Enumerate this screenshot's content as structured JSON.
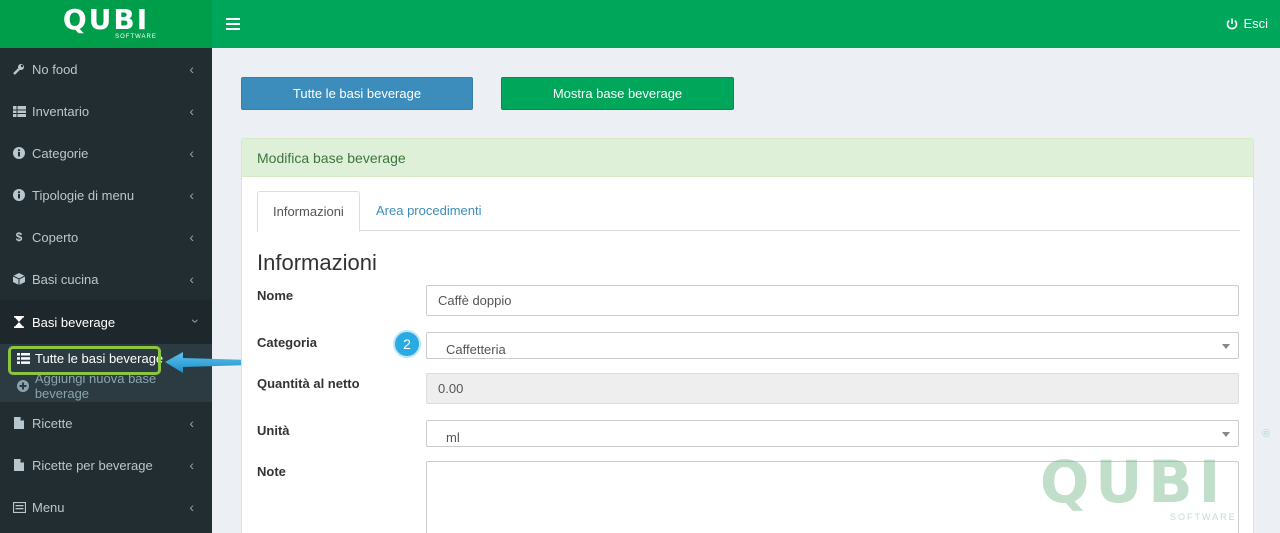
{
  "logo": {
    "text": "QUBI",
    "sub": "SOFTWARE"
  },
  "header": {
    "logout_label": "Esci"
  },
  "sidebar": {
    "items": [
      {
        "label": "No food",
        "icon": "wrench-icon"
      },
      {
        "label": "Inventario",
        "icon": "table-icon"
      },
      {
        "label": "Categorie",
        "icon": "info-icon"
      },
      {
        "label": "Tipologie di menu",
        "icon": "info-icon"
      },
      {
        "label": "Coperto",
        "icon": "dollar-icon"
      },
      {
        "label": "Basi cucina",
        "icon": "cube-icon"
      },
      {
        "label": "Basi beverage",
        "icon": "hourglass-icon"
      },
      {
        "label": "Ricette",
        "icon": "file-icon"
      },
      {
        "label": "Ricette per beverage",
        "icon": "file-icon"
      },
      {
        "label": "Menu",
        "icon": "list-alt-icon"
      }
    ],
    "submenu": [
      {
        "label": "Tutte le basi beverage",
        "icon": "list-icon"
      },
      {
        "label": "Aggiungi nuova base beverage",
        "icon": "plus-circle-icon"
      }
    ]
  },
  "actions": {
    "all_label": "Tutte le basi beverage",
    "show_label": "Mostra base beverage"
  },
  "panel": {
    "title": "Modifica base beverage",
    "tabs": [
      {
        "label": "Informazioni"
      },
      {
        "label": "Area procedimenti"
      }
    ],
    "section_title": "Informazioni",
    "fields": {
      "nome": {
        "label": "Nome",
        "value": "Caffè doppio"
      },
      "categoria": {
        "label": "Categoria",
        "value": "Caffetteria"
      },
      "quantita": {
        "label": "Quantità al netto",
        "value": "0.00"
      },
      "unita": {
        "label": "Unità",
        "value": "ml"
      },
      "note": {
        "label": "Note",
        "value": ""
      }
    }
  },
  "annotation": {
    "step": "2"
  },
  "watermark": {
    "text": "QUBI",
    "sub": "SOFTWARE",
    "reg": "®"
  },
  "colors": {
    "green": "#00a65a",
    "blue": "#3c8dbc",
    "sidebar": "#222d32",
    "highlight": "#8cc63f",
    "badge": "#29abe2"
  }
}
